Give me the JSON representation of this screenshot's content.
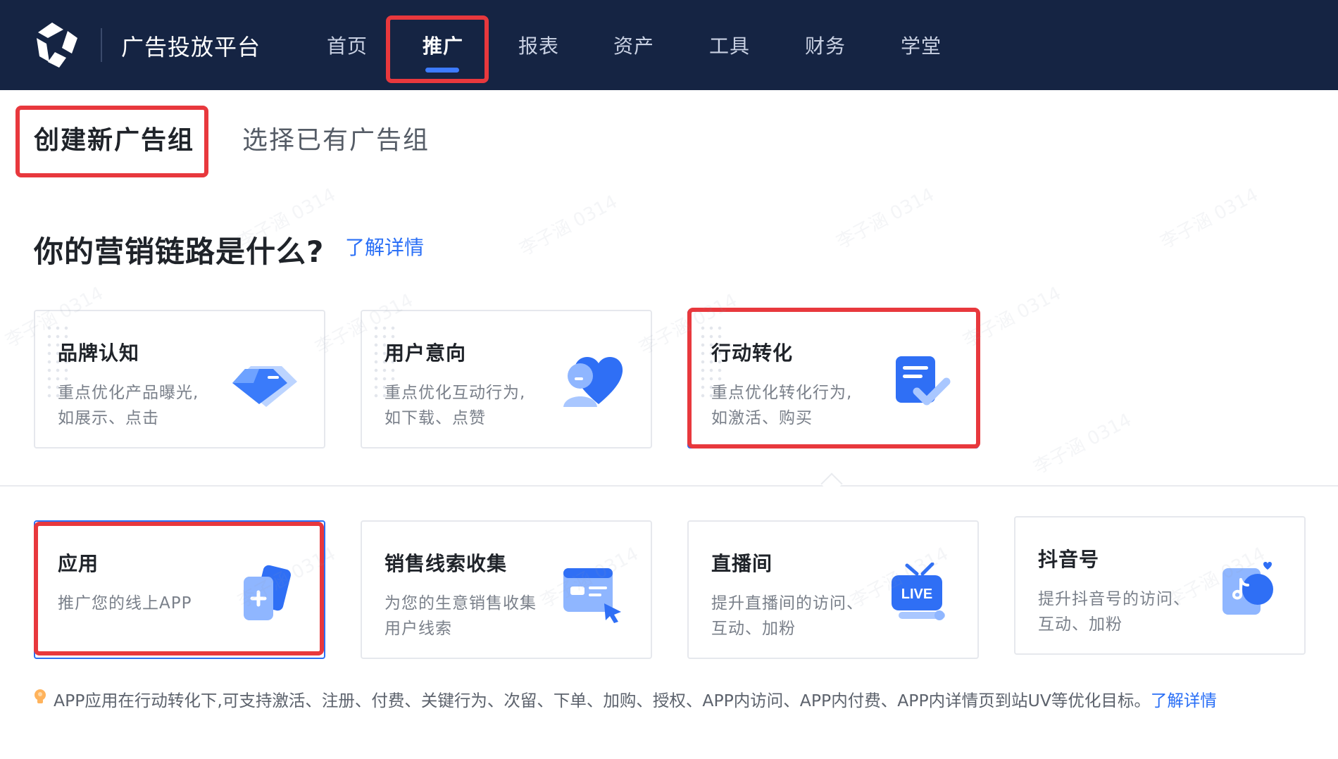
{
  "header": {
    "platform_title": "广告投放平台",
    "nav": [
      {
        "label": "首页",
        "active": false
      },
      {
        "label": "推广",
        "active": true
      },
      {
        "label": "报表",
        "active": false
      },
      {
        "label": "资产",
        "active": false
      },
      {
        "label": "工具",
        "active": false
      },
      {
        "label": "财务",
        "active": false
      },
      {
        "label": "学堂",
        "active": false
      }
    ]
  },
  "tabs": [
    {
      "label": "创建新广告组",
      "active": true
    },
    {
      "label": "选择已有广告组",
      "active": false
    }
  ],
  "section": {
    "question": "你的营销链路是什么?",
    "learn_more": "了解详情"
  },
  "marketing_goals": [
    {
      "title": "品牌认知",
      "desc_line1": "重点优化产品曝光,",
      "desc_line2": "如展示、点击",
      "icon": "diamond-icon",
      "selected": false
    },
    {
      "title": "用户意向",
      "desc_line1": "重点优化互动行为,",
      "desc_line2": "如下载、点赞",
      "icon": "heart-user-icon",
      "selected": false
    },
    {
      "title": "行动转化",
      "desc_line1": "重点优化转化行为,",
      "desc_line2": "如激活、购买",
      "icon": "document-check-icon",
      "selected": true
    }
  ],
  "promotion_targets": [
    {
      "title": "应用",
      "desc_line1": "推广您的线上APP",
      "desc_line2": "",
      "icon": "app-add-icon",
      "selected": true
    },
    {
      "title": "销售线索收集",
      "desc_line1": "为您的生意销售收集",
      "desc_line2": "用户线索",
      "icon": "form-cursor-icon",
      "selected": false
    },
    {
      "title": "直播间",
      "desc_line1": "提升直播间的访问、",
      "desc_line2": "互动、加粉",
      "icon": "live-tv-icon",
      "selected": false
    },
    {
      "title": "抖音号",
      "desc_line1": "提升抖音号的访问、",
      "desc_line2": "互动、加粉",
      "icon": "douyin-icon",
      "selected": false
    }
  ],
  "tip": {
    "text": "APP应用在行动转化下,可支持激活、注册、付费、关键行为、次留、下单、加购、授权、APP内访问、APP内付费、APP内详情页到站UV等优化目标。",
    "link": "了解详情"
  },
  "watermark_text": "李子涵 0314",
  "colors": {
    "header_bg": "#152443",
    "accent_blue": "#2a6ff6",
    "highlight_red": "#e8383d"
  }
}
